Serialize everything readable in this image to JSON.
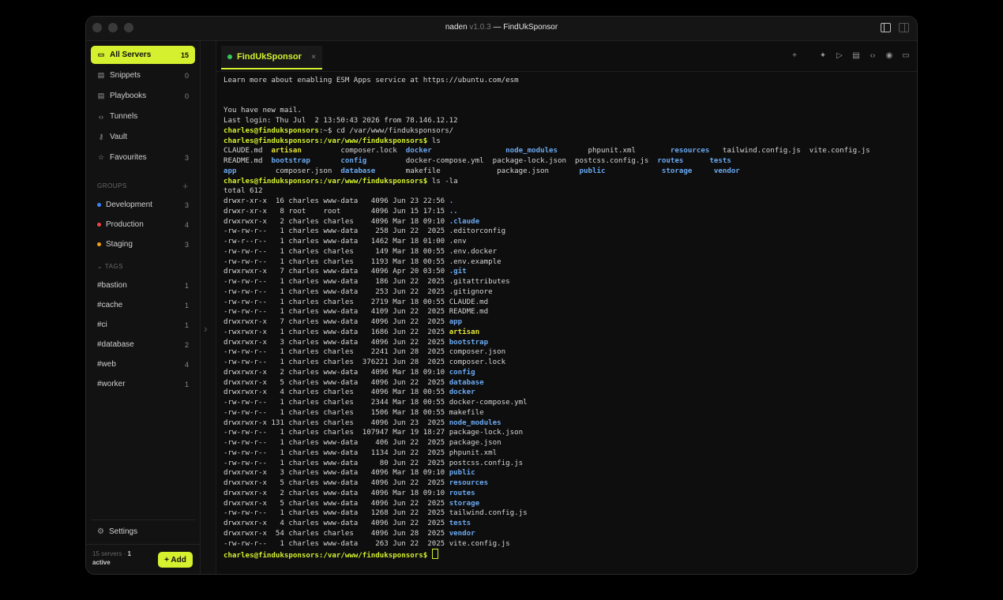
{
  "window": {
    "app": "naden",
    "version": "v1.0.3",
    "sep": "—",
    "project": "FindUkSponsor"
  },
  "sidebar": {
    "nav": [
      {
        "label": "All Servers",
        "count": "15",
        "icon": "server-icon"
      },
      {
        "label": "Snippets",
        "count": "0",
        "icon": "snippet-icon"
      },
      {
        "label": "Playbooks",
        "count": "0",
        "icon": "playbook-icon"
      },
      {
        "label": "Tunnels",
        "count": "",
        "icon": "tunnel-icon"
      },
      {
        "label": "Vault",
        "count": "",
        "icon": "key-icon"
      },
      {
        "label": "Favourites",
        "count": "3",
        "icon": "star-icon"
      }
    ],
    "groups_title": "GROUPS",
    "groups": [
      {
        "label": "Development",
        "count": "3",
        "color": "#3b82f6"
      },
      {
        "label": "Production",
        "count": "4",
        "color": "#ef4444"
      },
      {
        "label": "Staging",
        "count": "3",
        "color": "#f59e0b"
      }
    ],
    "tags_title": "TAGS",
    "tags": [
      {
        "label": "#bastion",
        "count": "1"
      },
      {
        "label": "#cache",
        "count": "1"
      },
      {
        "label": "#ci",
        "count": "1"
      },
      {
        "label": "#database",
        "count": "2"
      },
      {
        "label": "#web",
        "count": "4"
      },
      {
        "label": "#worker",
        "count": "1"
      }
    ],
    "settings": "Settings",
    "footer": {
      "servers": "15 servers",
      "dot": "·",
      "active_count": "1",
      "active": "active",
      "add": "+ Add"
    }
  },
  "tab": {
    "label": "FindUkSponsor",
    "close": "×"
  },
  "terminal": {
    "lines": [
      "Learn more about enabling ESM Apps service at https://ubuntu.com/esm",
      "",
      "",
      "You have new mail.",
      "Last login: Thu Jul  2 13:50:43 2026 from 78.146.12.12"
    ],
    "prompt_home": "charles@finduksponsors",
    "cmd1": ":~$ cd /var/www/finduksponsors/",
    "prompt_path": "charles@finduksponsors:/var/www/finduksponsors$",
    "cmd2": " ls",
    "ls_rows": [
      [
        [
          "CLAUDE.md  ",
          ""
        ],
        [
          "artisan    ",
          "e"
        ],
        [
          "     composer.lock  ",
          ""
        ],
        [
          "docker   ",
          "d"
        ],
        [
          "              ",
          ""
        ],
        [
          "node_modules",
          "d"
        ],
        [
          "       phpunit.xml        ",
          ""
        ],
        [
          "resources",
          "d"
        ],
        [
          "   tailwind.config.js  vite.config.js",
          ""
        ]
      ],
      [
        [
          "README.md  ",
          ""
        ],
        [
          "bootstrap  ",
          "d"
        ],
        [
          "     ",
          ""
        ],
        [
          "config   ",
          "d"
        ],
        [
          "      docker-compose.yml  package-lock.json  postcss.config.js  ",
          ""
        ],
        [
          "routes   ",
          "d"
        ],
        [
          "   ",
          ""
        ],
        [
          "tests",
          "d"
        ]
      ],
      [
        [
          "app  ",
          "d"
        ],
        [
          "       composer.json  ",
          ""
        ],
        [
          "database",
          "d"
        ],
        [
          "       makefile             package.json       ",
          ""
        ],
        [
          "public",
          "d"
        ],
        [
          "             ",
          ""
        ],
        [
          "storage",
          "d"
        ],
        [
          "     ",
          ""
        ],
        [
          "vendor",
          "d"
        ]
      ]
    ],
    "cmd3": " ls -la",
    "total": "total 612",
    "la": [
      [
        "drwxr-xr-x  16 charles www-data   4096 Jun 23 22:56 ",
        ".",
        "d"
      ],
      [
        "drwxr-xr-x   8 root    root       4096 Jun 15 17:15 ",
        "..",
        "d"
      ],
      [
        "drwxrwxr-x   2 charles charles    4096 Mar 18 09:10 ",
        ".claude",
        "d"
      ],
      [
        "-rw-rw-r--   1 charles www-data    258 Jun 22  2025 ",
        ".editorconfig",
        ""
      ],
      [
        "-rw-r--r--   1 charles www-data   1462 Mar 18 01:00 ",
        ".env",
        ""
      ],
      [
        "-rw-rw-r--   1 charles charles     149 Mar 18 00:55 ",
        ".env.docker",
        ""
      ],
      [
        "-rw-rw-r--   1 charles charles    1193 Mar 18 00:55 ",
        ".env.example",
        ""
      ],
      [
        "drwxrwxr-x   7 charles www-data   4096 Apr 20 03:50 ",
        ".git",
        "d"
      ],
      [
        "-rw-rw-r--   1 charles www-data    186 Jun 22  2025 ",
        ".gitattributes",
        ""
      ],
      [
        "-rw-rw-r--   1 charles www-data    253 Jun 22  2025 ",
        ".gitignore",
        ""
      ],
      [
        "-rw-rw-r--   1 charles charles    2719 Mar 18 00:55 ",
        "CLAUDE.md",
        ""
      ],
      [
        "-rw-rw-r--   1 charles www-data   4109 Jun 22  2025 ",
        "README.md",
        ""
      ],
      [
        "drwxrwxr-x   7 charles www-data   4096 Jun 22  2025 ",
        "app",
        "d"
      ],
      [
        "-rwxrwxr-x   1 charles www-data   1686 Jun 22  2025 ",
        "artisan",
        "e"
      ],
      [
        "drwxrwxr-x   3 charles www-data   4096 Jun 22  2025 ",
        "bootstrap",
        "d"
      ],
      [
        "-rw-rw-r--   1 charles charles    2241 Jun 28  2025 ",
        "composer.json",
        ""
      ],
      [
        "-rw-rw-r--   1 charles charles  376221 Jun 28  2025 ",
        "composer.lock",
        ""
      ],
      [
        "drwxrwxr-x   2 charles www-data   4096 Mar 18 09:10 ",
        "config",
        "d"
      ],
      [
        "drwxrwxr-x   5 charles www-data   4096 Jun 22  2025 ",
        "database",
        "d"
      ],
      [
        "drwxrwxr-x   4 charles charles    4096 Mar 18 00:55 ",
        "docker",
        "d"
      ],
      [
        "-rw-rw-r--   1 charles charles    2344 Mar 18 00:55 ",
        "docker-compose.yml",
        ""
      ],
      [
        "-rw-rw-r--   1 charles charles    1506 Mar 18 00:55 ",
        "makefile",
        ""
      ],
      [
        "drwxrwxr-x 131 charles charles    4096 Jun 23  2025 ",
        "node_modules",
        "d"
      ],
      [
        "-rw-rw-r--   1 charles charles  107947 Mar 19 18:27 ",
        "package-lock.json",
        ""
      ],
      [
        "-rw-rw-r--   1 charles www-data    406 Jun 22  2025 ",
        "package.json",
        ""
      ],
      [
        "-rw-rw-r--   1 charles www-data   1134 Jun 22  2025 ",
        "phpunit.xml",
        ""
      ],
      [
        "-rw-rw-r--   1 charles www-data     80 Jun 22  2025 ",
        "postcss.config.js",
        ""
      ],
      [
        "drwxrwxr-x   3 charles www-data   4096 Mar 18 09:10 ",
        "public",
        "d"
      ],
      [
        "drwxrwxr-x   5 charles www-data   4096 Jun 22  2025 ",
        "resources",
        "d"
      ],
      [
        "drwxrwxr-x   2 charles www-data   4096 Mar 18 09:10 ",
        "routes",
        "d"
      ],
      [
        "drwxrwxr-x   5 charles www-data   4096 Jun 22  2025 ",
        "storage",
        "d"
      ],
      [
        "-rw-rw-r--   1 charles www-data   1268 Jun 22  2025 ",
        "tailwind.config.js",
        ""
      ],
      [
        "drwxrwxr-x   4 charles www-data   4096 Jun 22  2025 ",
        "tests",
        "d"
      ],
      [
        "drwxrwxr-x  54 charles charles    4096 Jun 28  2025 ",
        "vendor",
        "d"
      ],
      [
        "-rw-rw-r--   1 charles www-data    263 Jun 22  2025 ",
        "vite.config.js",
        ""
      ]
    ]
  }
}
